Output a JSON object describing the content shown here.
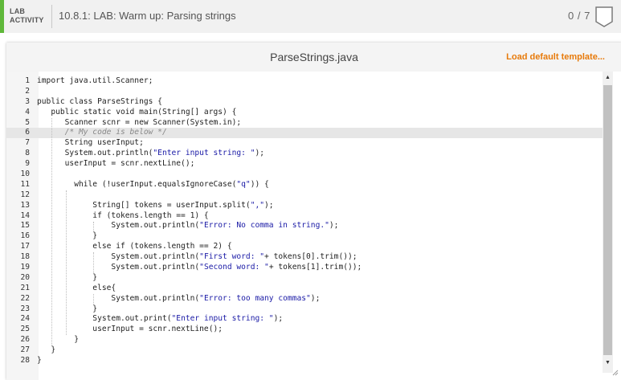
{
  "header": {
    "activity_label_line1": "LAB",
    "activity_label_line2": "ACTIVITY",
    "title": "10.8.1: LAB: Warm up: Parsing strings",
    "score": "0 / 7",
    "accent_color": "#5fb83a"
  },
  "editor_panel": {
    "file_name": "ParseStrings.java",
    "load_default_label": "Load default template...",
    "load_default_color": "#e77a0a"
  },
  "code": {
    "active_line": 6,
    "lines": [
      {
        "n": "1",
        "parts": [
          {
            "t": "import java.util.Scanner;"
          }
        ]
      },
      {
        "n": "2",
        "parts": []
      },
      {
        "n": "3",
        "parts": [
          {
            "t": "public class ParseStrings {"
          }
        ]
      },
      {
        "n": "4",
        "parts": [
          {
            "t": "   public static void main(String[] args) {"
          }
        ]
      },
      {
        "n": "5",
        "parts": [
          {
            "t": "      Scanner scnr = new Scanner(System.in);"
          }
        ]
      },
      {
        "n": "6",
        "parts": [
          {
            "t": "      "
          },
          {
            "t": "/* My code is below */",
            "c": "comment"
          }
        ]
      },
      {
        "n": "7",
        "parts": [
          {
            "t": "      String userInput;"
          }
        ]
      },
      {
        "n": "8",
        "parts": [
          {
            "t": "      System.out.println("
          },
          {
            "t": "\"Enter input string: \"",
            "c": "string"
          },
          {
            "t": ");"
          }
        ]
      },
      {
        "n": "9",
        "parts": [
          {
            "t": "      userInput = scnr.nextLine();"
          }
        ]
      },
      {
        "n": "10",
        "parts": []
      },
      {
        "n": "11",
        "parts": [
          {
            "t": "        while (!userInput.equalsIgnoreCase("
          },
          {
            "t": "\"q\"",
            "c": "string"
          },
          {
            "t": ")) {"
          }
        ]
      },
      {
        "n": "12",
        "parts": []
      },
      {
        "n": "13",
        "parts": [
          {
            "t": "            String[] tokens = userInput.split("
          },
          {
            "t": "\",\"",
            "c": "string"
          },
          {
            "t": ");"
          }
        ]
      },
      {
        "n": "14",
        "parts": [
          {
            "t": "            if (tokens.length == 1) {"
          }
        ]
      },
      {
        "n": "15",
        "parts": [
          {
            "t": "                System.out.println("
          },
          {
            "t": "\"Error: No comma in string.\"",
            "c": "string"
          },
          {
            "t": ");"
          }
        ]
      },
      {
        "n": "16",
        "parts": [
          {
            "t": "            }"
          }
        ]
      },
      {
        "n": "17",
        "parts": [
          {
            "t": "            else if (tokens.length == 2) {"
          }
        ]
      },
      {
        "n": "18",
        "parts": [
          {
            "t": "                System.out.println("
          },
          {
            "t": "\"First word: \"",
            "c": "string"
          },
          {
            "t": "+ tokens[0].trim());"
          }
        ]
      },
      {
        "n": "19",
        "parts": [
          {
            "t": "                System.out.println("
          },
          {
            "t": "\"Second word: \"",
            "c": "string"
          },
          {
            "t": "+ tokens[1].trim());"
          }
        ]
      },
      {
        "n": "20",
        "parts": [
          {
            "t": "            }"
          }
        ]
      },
      {
        "n": "21",
        "parts": [
          {
            "t": "            else{"
          }
        ]
      },
      {
        "n": "22",
        "parts": [
          {
            "t": "                System.out.println("
          },
          {
            "t": "\"Error: too many commas\"",
            "c": "string"
          },
          {
            "t": ");"
          }
        ]
      },
      {
        "n": "23",
        "parts": [
          {
            "t": "            }"
          }
        ]
      },
      {
        "n": "24",
        "parts": [
          {
            "t": "            System.out.print("
          },
          {
            "t": "\"Enter input string: \"",
            "c": "string"
          },
          {
            "t": ");"
          }
        ]
      },
      {
        "n": "25",
        "parts": [
          {
            "t": "            userInput = scnr.nextLine();"
          }
        ]
      },
      {
        "n": "26",
        "parts": [
          {
            "t": "        }"
          }
        ]
      },
      {
        "n": "27",
        "parts": [
          {
            "t": "   }"
          }
        ]
      },
      {
        "n": "28",
        "parts": [
          {
            "t": "}"
          }
        ]
      }
    ]
  },
  "scrollbar": {
    "up_icon": "triangle-up-icon",
    "down_icon": "triangle-down-icon"
  }
}
